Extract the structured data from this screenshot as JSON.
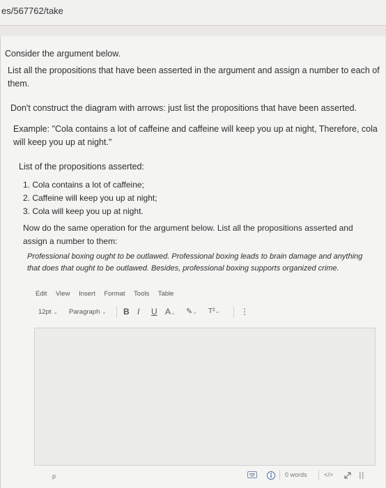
{
  "browser": {
    "url": "es/567762/take"
  },
  "question": {
    "intro": "Consider the argument below.",
    "instruction": "List all the propositions that have been asserted in the argument and assign a number to each of them.",
    "note": "Don't construct the diagram with arrows: just list the propositions that have been asserted.",
    "example": "Example: \"Cola contains a lot of caffeine and caffeine will keep you up at night, Therefore, cola will keep you up at night.\"",
    "list_heading": "List of the propositions asserted:",
    "propositions": [
      "1. Cola contains a lot of caffeine;",
      "2. Caffeine will keep you up at night;",
      "3. Cola will keep you up at night."
    ],
    "task": "Now do the same operation for the argument below. List all the propositions asserted and assign a number to them:",
    "argument": "Professional boxing ought to be outlawed. Professional boxing leads to brain damage and anything that does that ought to be outlawed. Besides, professional boxing supports organized crime."
  },
  "editor": {
    "menu": [
      "Edit",
      "View",
      "Insert",
      "Format",
      "Tools",
      "Table"
    ],
    "font_size": "12pt",
    "block_format": "Paragraph",
    "bold": "B",
    "italic": "I",
    "underline": "U",
    "text_color": "A",
    "highlight": "✎",
    "superscript": "T²",
    "more": "⋮",
    "path": "p",
    "word_count": "0 words",
    "html_toggle": "</>"
  }
}
